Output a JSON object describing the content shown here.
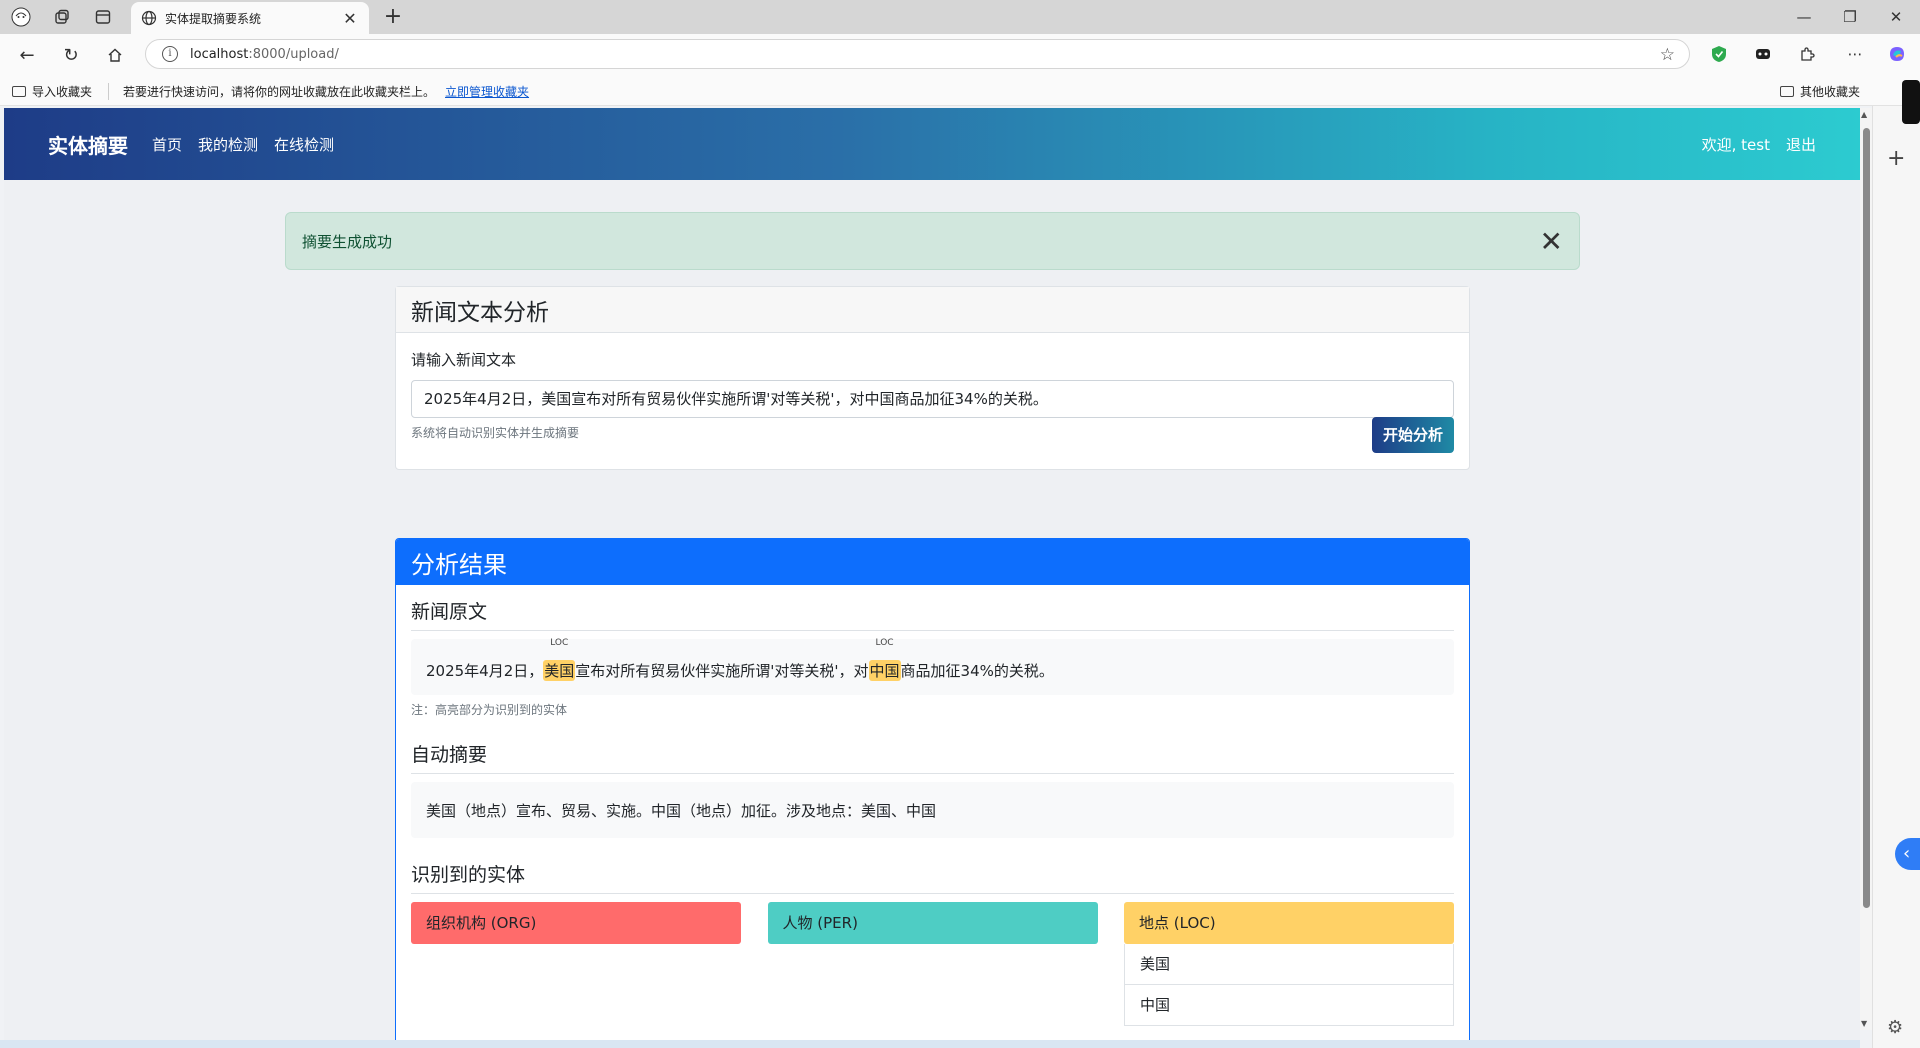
{
  "browser": {
    "tab_title": "实体提取摘要系统",
    "url_host": "localhost",
    "url_rest": ":8000/upload/",
    "bookmarks": {
      "import": "导入收藏夹",
      "hint": "若要进行快速访问，请将你的网址收藏放在此收藏夹栏上。",
      "manage": "立即管理收藏夹",
      "other": "其他收藏夹"
    }
  },
  "navbar": {
    "brand": "实体摘要",
    "links": [
      "首页",
      "我的检测",
      "在线检测"
    ],
    "welcome": "欢迎, test",
    "logout": "退出"
  },
  "alert": {
    "message": "摘要生成成功",
    "close": "✕"
  },
  "analysis_form": {
    "title": "新闻文本分析",
    "label": "请输入新闻文本",
    "value": "2025年4月2日，美国宣布对所有贸易伙伴实施所谓'对等关税'，对中国商品加征34%的关税。",
    "help": "系统将自动识别实体并生成摘要",
    "submit": "开始分析"
  },
  "results": {
    "title": "分析结果",
    "original_title": "新闻原文",
    "original_segments": {
      "s1": "2025年4月2日，",
      "e1": "美国",
      "e1_tag": "LOC",
      "s2": "宣布对所有贸易伙伴实施所谓'对等关税'，对",
      "e2": "中国",
      "e2_tag": "LOC",
      "s3": "商品加征34%的关税。"
    },
    "note": "注：高亮部分为识别到的实体",
    "summary_title": "自动摘要",
    "summary": "美国（地点）宣布、贸易、实施。中国（地点）加征。涉及地点：美国、中国",
    "entities_title": "识别到的实体",
    "entity_groups": [
      {
        "label": "组织机构 (ORG)",
        "color": "#ff6b6b",
        "items": []
      },
      {
        "label": "人物 (PER)",
        "color": "#4ecdc4",
        "items": []
      },
      {
        "label": "地点 (LOC)",
        "color": "#ffd166",
        "items": [
          "美国",
          "中国"
        ]
      }
    ]
  }
}
